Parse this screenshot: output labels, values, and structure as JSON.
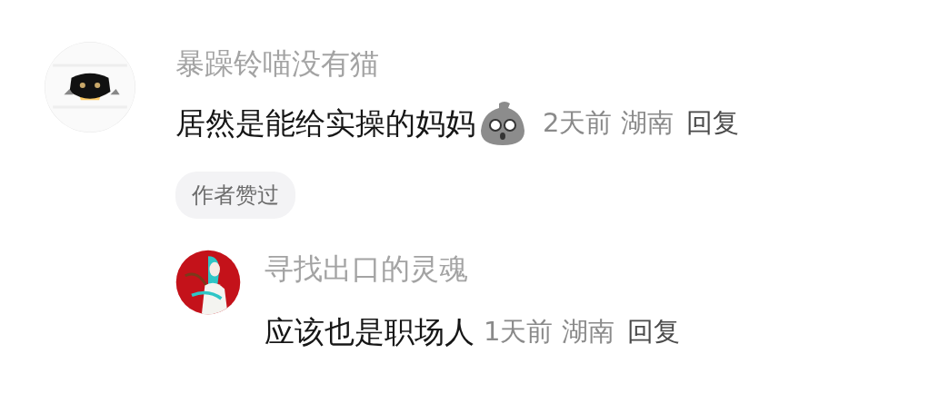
{
  "comments": [
    {
      "author": "暴躁铃喵没有猫",
      "text": "居然是能给实操的妈妈",
      "emoji": true,
      "time": "2天前",
      "region": "湖南",
      "reply": "回复",
      "badge": "作者赞过",
      "replies": [
        {
          "author": "寻找出口的灵魂",
          "text": "应该也是职场人",
          "emoji": false,
          "time": "1天前",
          "region": "湖南",
          "reply": "回复"
        }
      ]
    }
  ]
}
